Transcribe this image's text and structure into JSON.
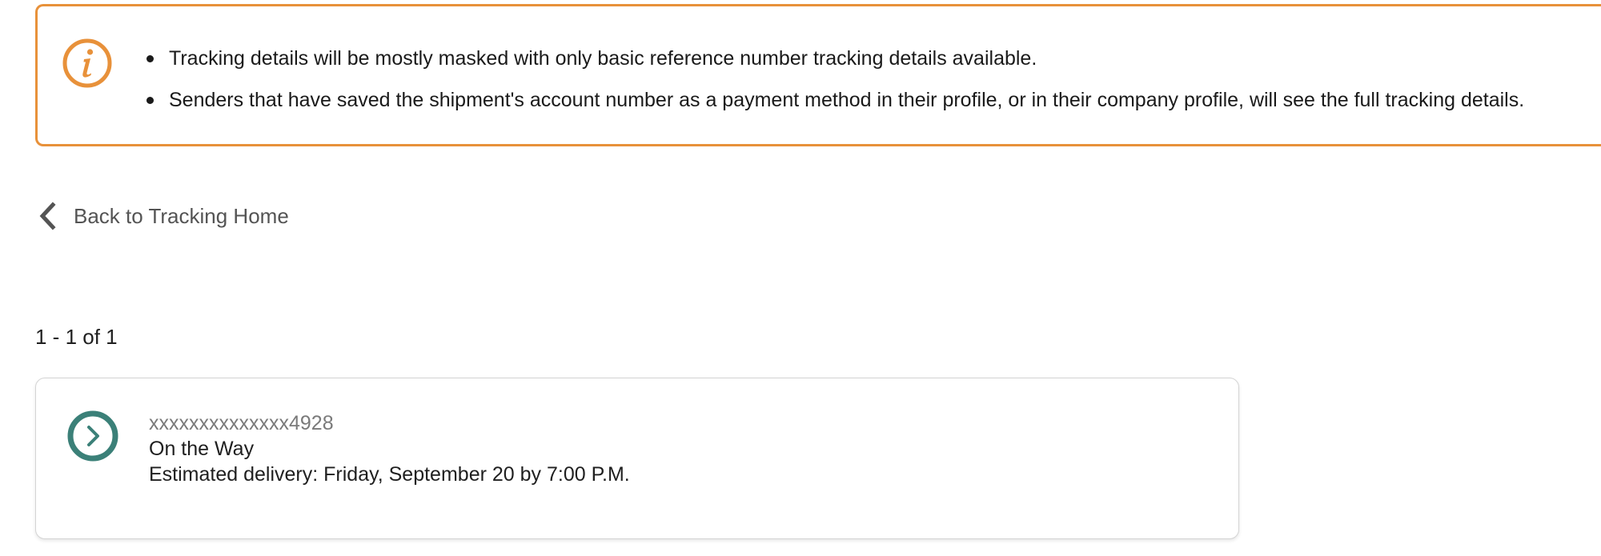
{
  "colors": {
    "notice_border": "#e8913a",
    "notice_icon": "#e8913a",
    "card_icon": "#3b8078",
    "muted_text": "#545454"
  },
  "notice": {
    "icon": "info-icon",
    "items": [
      "Tracking details will be mostly masked with only basic reference number tracking details available.",
      "Senders that have saved the shipment's account number as a payment method in their profile, or in their company profile, will see the full tracking details."
    ]
  },
  "back_link": {
    "icon": "chevron-left-icon",
    "label": "Back to Tracking Home"
  },
  "results": {
    "count_text": "1 - 1 of 1"
  },
  "shipments": [
    {
      "icon": "chevron-right-circle-icon",
      "tracking_number": "xxxxxxxxxxxxxx4928",
      "status": "On the Way",
      "estimated_delivery": "Estimated delivery: Friday, September 20 by 7:00 P.M."
    }
  ]
}
